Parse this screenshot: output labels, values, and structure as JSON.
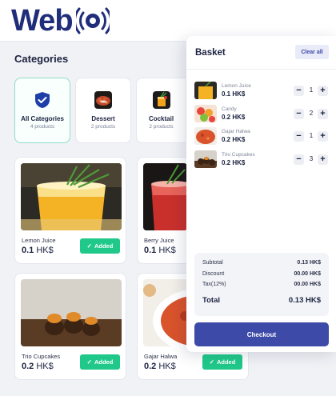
{
  "brand": {
    "name": "Web",
    "color": "#1f2d7a",
    "icon": "target-signal-icon"
  },
  "categories": {
    "title": "Categories",
    "items": [
      {
        "name": "All Categories",
        "count": "4 products",
        "icon": "shield-check-icon",
        "active": true
      },
      {
        "name": "Dessert",
        "count": "2 products",
        "icon": "dessert-thumbnail",
        "active": false
      },
      {
        "name": "Cocktail",
        "count": "2 products",
        "icon": "cocktail-thumbnail",
        "active": false
      }
    ]
  },
  "currency": "HK$",
  "products": [
    {
      "name": "Lemon Juice",
      "price": "0.1",
      "button": "Added"
    },
    {
      "name": "Berry Juice",
      "price": "0.1",
      "button": ""
    },
    {
      "name": "Trio Cupcakes",
      "price": "0.2",
      "button": "Added"
    },
    {
      "name": "Gajar Halwa",
      "price": "0.2",
      "button": "Added"
    }
  ],
  "basket": {
    "title": "Basket",
    "clear_label": "Clear all",
    "items": [
      {
        "name": "Lemon Juice",
        "price": "0.1 HK$",
        "qty": "1",
        "minus": "−",
        "plus": "+"
      },
      {
        "name": "Candy",
        "price": "0.2 HK$",
        "qty": "2",
        "minus": "−",
        "plus": "+"
      },
      {
        "name": "Gajar Halwa",
        "price": "0.2 HK$",
        "qty": "1",
        "minus": "−",
        "plus": "+"
      },
      {
        "name": "Trio Cupcakes",
        "price": "0.2 HK$",
        "qty": "3",
        "minus": "−",
        "plus": "+"
      }
    ],
    "summary": {
      "subtotal_label": "Subtotal",
      "subtotal_value": "0.13 HK$",
      "discount_label": "Discount",
      "discount_value": "00.00 HK$",
      "tax_label": "Tax(12%)",
      "tax_value": "00.00 HK$",
      "total_label": "Total",
      "total_value": "0.13 HK$"
    },
    "checkout_label": "Checkout"
  },
  "colors": {
    "accent": "#3d4aa8",
    "added": "#20c98a",
    "background": "#f1f2f6"
  }
}
